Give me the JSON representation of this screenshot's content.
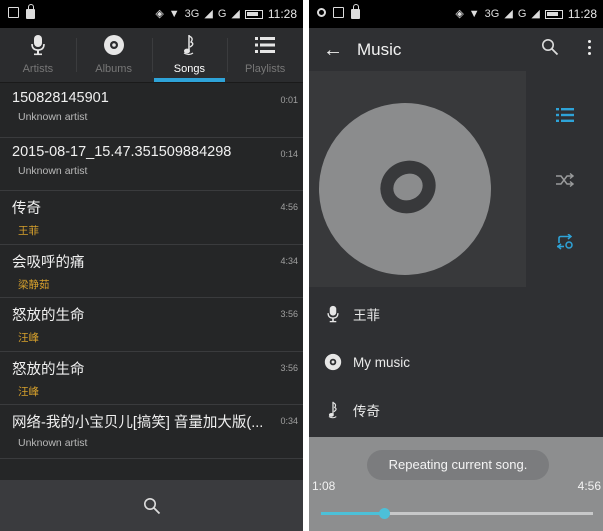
{
  "status": {
    "network": "3G",
    "signal_label": "G",
    "time_left": "11:28",
    "time_right": "11:28"
  },
  "tabs": [
    {
      "label": "Artists",
      "icon": "microphone-icon"
    },
    {
      "label": "Albums",
      "icon": "disc-icon"
    },
    {
      "label": "Songs",
      "icon": "music-note-icon",
      "active": true
    },
    {
      "label": "Playlists",
      "icon": "list-icon"
    }
  ],
  "songs": [
    {
      "title": "150828145901",
      "artist": "Unknown artist",
      "duration": "0:01",
      "unknown": true
    },
    {
      "title": "2015-08-17_15.47.351509884298",
      "artist": "Unknown artist",
      "duration": "0:14",
      "unknown": true
    },
    {
      "title": "传奇",
      "artist": "王菲",
      "duration": "4:56",
      "unknown": false
    },
    {
      "title": "会吸呼的痛",
      "artist": "梁静茹",
      "duration": "4:34",
      "unknown": false
    },
    {
      "title": "怒放的生命",
      "artist": "汪峰",
      "duration": "3:56",
      "unknown": false
    },
    {
      "title": "怒放的生命",
      "artist": "汪峰",
      "duration": "3:56",
      "unknown": false
    },
    {
      "title": "网络-我的小宝贝儿[搞笑] 音量加大版(...",
      "artist": "Unknown artist",
      "duration": "0:34",
      "unknown": true
    }
  ],
  "now_playing": {
    "toolbar_title": "Music",
    "artist": "王菲",
    "album": "My music",
    "song": "传奇",
    "toast": "Repeating current song.",
    "current_time": "1:08",
    "total_time": "4:56",
    "progress": 0.23
  },
  "colors": {
    "accent": "#2ea3d8",
    "seek": "#4cc0d8",
    "artist_highlight": "#d6a02c"
  }
}
